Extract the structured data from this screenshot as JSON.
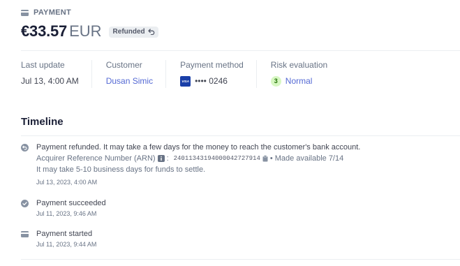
{
  "header": {
    "section_label": "PAYMENT",
    "section_icon": "payment-card-icon"
  },
  "payment": {
    "amount": "€33.57",
    "currency": "EUR",
    "status": "Refunded",
    "status_icon": "refund-arrow-icon"
  },
  "meta": {
    "last_update": {
      "label": "Last update",
      "value": "Jul 13, 4:00 AM"
    },
    "customer": {
      "label": "Customer",
      "value": "Dusan Simic"
    },
    "payment_method": {
      "label": "Payment method",
      "brand": "VISA",
      "masked": "•••• 0246"
    },
    "risk": {
      "label": "Risk evaluation",
      "score": "3",
      "value": "Normal"
    }
  },
  "timeline": {
    "title": "Timeline",
    "events": [
      {
        "icon": "refund-icon",
        "title": "Payment refunded. It may take a few days for the money to reach the customer's bank account.",
        "arn_label": "Acquirer Reference Number (ARN)",
        "arn_value": "24011343194000042727914",
        "arn_suffix": "• Made available 7/14",
        "note": "It may take 5-10 business days for funds to settle.",
        "time": "Jul 13, 2023, 4:00 AM"
      },
      {
        "icon": "check-circle-icon",
        "title": "Payment succeeded",
        "time": "Jul 11, 2023, 9:46 AM"
      },
      {
        "icon": "payment-card-icon",
        "title": "Payment started",
        "time": "Jul 11, 2023, 9:44 AM"
      }
    ]
  },
  "colors": {
    "link": "#5469d4",
    "text": "#1a1f36",
    "muted": "#687385",
    "risk_bg": "#d7f7c2",
    "visa": "#1a3fa8"
  }
}
